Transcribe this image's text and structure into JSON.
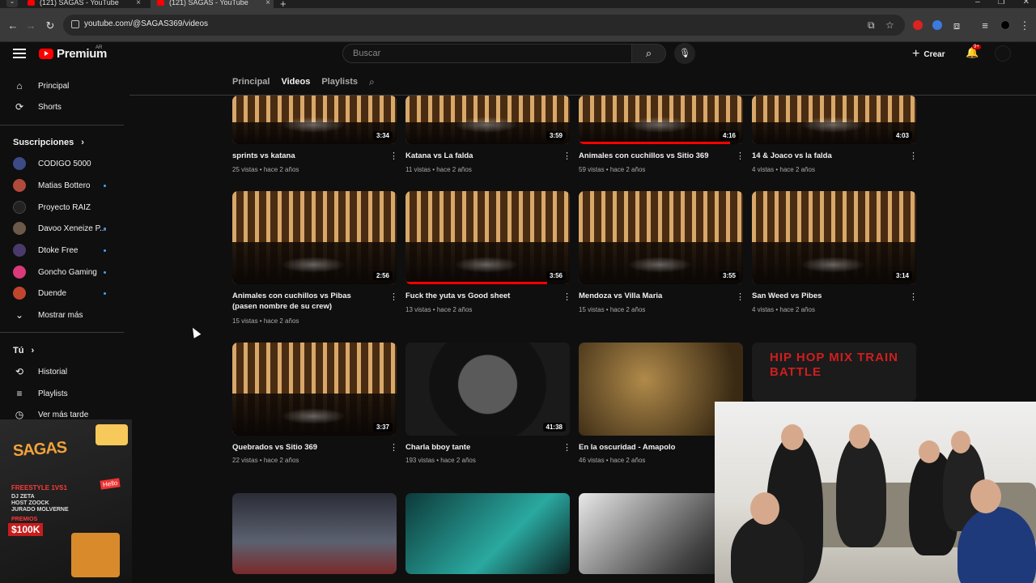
{
  "browser": {
    "tabs": [
      {
        "title": "(121) SAGAS - YouTube"
      },
      {
        "title": "(121) SAGAS - YouTube"
      }
    ],
    "url": "youtube.com/@SAGAS369/videos"
  },
  "header": {
    "logo_text": "Premium",
    "country_code": "AR",
    "search_placeholder": "Buscar",
    "create_label": "Crear",
    "notif_badge": "9+"
  },
  "sidebar": {
    "main": [
      {
        "label": "Principal",
        "icon": "home-icon"
      },
      {
        "label": "Shorts",
        "icon": "shorts-icon"
      }
    ],
    "subs_heading": "Suscripciones",
    "subscriptions": [
      {
        "label": "CODIGO 5000",
        "new": false,
        "color": "#3c4a86"
      },
      {
        "label": "Matias Bottero",
        "new": true,
        "color": "#b04a3a"
      },
      {
        "label": "Proyecto RAIZ",
        "new": false,
        "color": "#222222"
      },
      {
        "label": "Davoo Xeneize P...",
        "new": true,
        "color": "#6b5a4a"
      },
      {
        "label": "Dtoke Free",
        "new": true,
        "color": "#4a3a6b"
      },
      {
        "label": "Goncho Gaming",
        "new": true,
        "color": "#d83a7a"
      },
      {
        "label": "Duende",
        "new": true,
        "color": "#c0452d"
      }
    ],
    "show_more": "Mostrar más",
    "you_heading": "Tú",
    "you_items": [
      {
        "label": "Historial",
        "icon": "history-icon"
      },
      {
        "label": "Playlists",
        "icon": "playlists-icon"
      },
      {
        "label": "Ver más tarde",
        "icon": "watch-later-icon"
      }
    ],
    "promo": {
      "title": "SAGAS",
      "line1": "FREESTYLE 1VS1",
      "line2": "DJ ZETA",
      "line3": "HOST ZOOCK",
      "line4": "JURADO MOLVERNE",
      "prizes": "PREMIOS",
      "amount": "$100K",
      "hello": "Hello"
    }
  },
  "channel_tabs": [
    {
      "label": "Principal",
      "active": false
    },
    {
      "label": "Videos",
      "active": true
    },
    {
      "label": "Playlists",
      "active": false
    }
  ],
  "videos": [
    {
      "title": "sprints vs katana",
      "meta": "25 vistas • hace 2 años",
      "duration": "3:34",
      "progress": 0
    },
    {
      "title": "Katana vs La falda",
      "meta": "11 vistas • hace 2 años",
      "duration": "3:59",
      "progress": 0
    },
    {
      "title": "Animales con cuchillos vs Sitio 369",
      "meta": "59 vistas • hace 2 años",
      "duration": "4:16",
      "progress": 0.92
    },
    {
      "title": "14 & Joaco vs la falda",
      "meta": "4 vistas • hace 2 años",
      "duration": "4:03",
      "progress": 0
    },
    {
      "title": "Animales con cuchillos vs Pibas (pasen nombre de su crew)",
      "meta": "15 vistas • hace 2 años",
      "duration": "2:56",
      "progress": 0
    },
    {
      "title": "Fuck the yuta vs Good sheet",
      "meta": "13 vistas • hace 2 años",
      "duration": "3:56",
      "progress": 0.86
    },
    {
      "title": "Mendoza vs Villa Maria",
      "meta": "15 vistas • hace 2 años",
      "duration": "3:55",
      "progress": 0
    },
    {
      "title": "San Weed vs Pibes",
      "meta": "4 vistas • hace 2 años",
      "duration": "3:14",
      "progress": 0
    },
    {
      "title": "Quebrados vs Sitio 369",
      "meta": "22 vistas • hace 2 años",
      "duration": "3:37",
      "progress": 0
    },
    {
      "title": "Charla bboy tante",
      "meta": "193 vistas • hace 2 años",
      "duration": "41:38",
      "progress": 0
    },
    {
      "title": "En la oscuridad - Amapolo",
      "meta": "46 vistas • hace 2 años",
      "duration": "",
      "progress": 0
    },
    {
      "title": "HIP HOP MIX TRAIN BATTLE",
      "meta": "",
      "duration": "",
      "progress": 0
    }
  ]
}
